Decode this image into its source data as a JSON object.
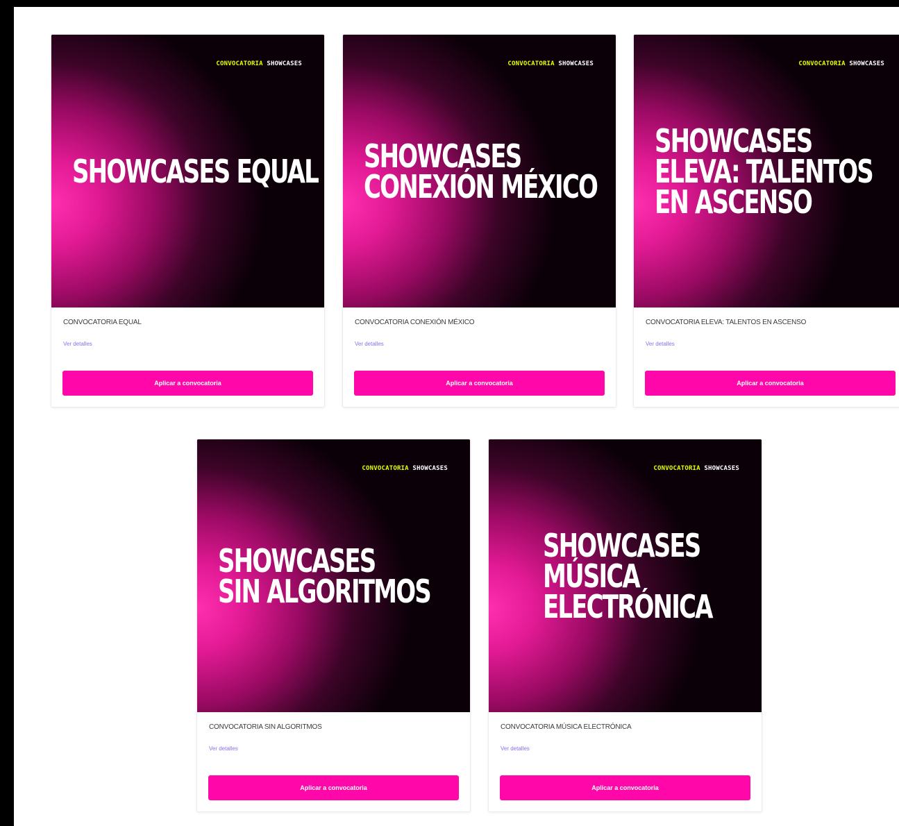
{
  "tag": {
    "highlight": "CONVOCATORIA",
    "rest": "SHOWCASES",
    "highlight_color": "#e6ff00"
  },
  "colors": {
    "accent": "#ff07a8",
    "link": "#8b6fe8",
    "poster_dark": "#0b0008",
    "poster_glow": "#ff2fb0"
  },
  "cards": [
    {
      "title_lines": [
        "SHOWCASES EQUAL"
      ],
      "name": "CONVOCATORIA EQUAL",
      "link": "Ver detalles",
      "button": "Aplicar a convocatoria"
    },
    {
      "title_lines": [
        "SHOWCASES",
        "CONEXIÓN MÉXICO"
      ],
      "name": "CONVOCATORIA CONEXIÓN MÉXICO",
      "link": "Ver detalles",
      "button": "Aplicar a convocatoria"
    },
    {
      "title_lines": [
        "SHOWCASES",
        "ELEVA: TALENTOS",
        "EN ASCENSO"
      ],
      "name": "CONVOCATORIA ELEVA: TALENTOS EN ASCENSO",
      "link": "Ver detalles",
      "button": "Aplicar a convocatoria"
    },
    {
      "title_lines": [
        "SHOWCASES",
        "SIN ALGORITMOS"
      ],
      "name": "CONVOCATORIA SIN ALGORITMOS",
      "link": "Ver detalles",
      "button": "Aplicar a convocatoria"
    },
    {
      "title_lines": [
        "SHOWCASES",
        "MÚSICA",
        "ELECTRÓNICA"
      ],
      "name": "CONVOCATORIA MÚSICA ELECTRÓNICA",
      "link": "Ver detalles",
      "button": "Aplicar a convocatoria"
    }
  ]
}
